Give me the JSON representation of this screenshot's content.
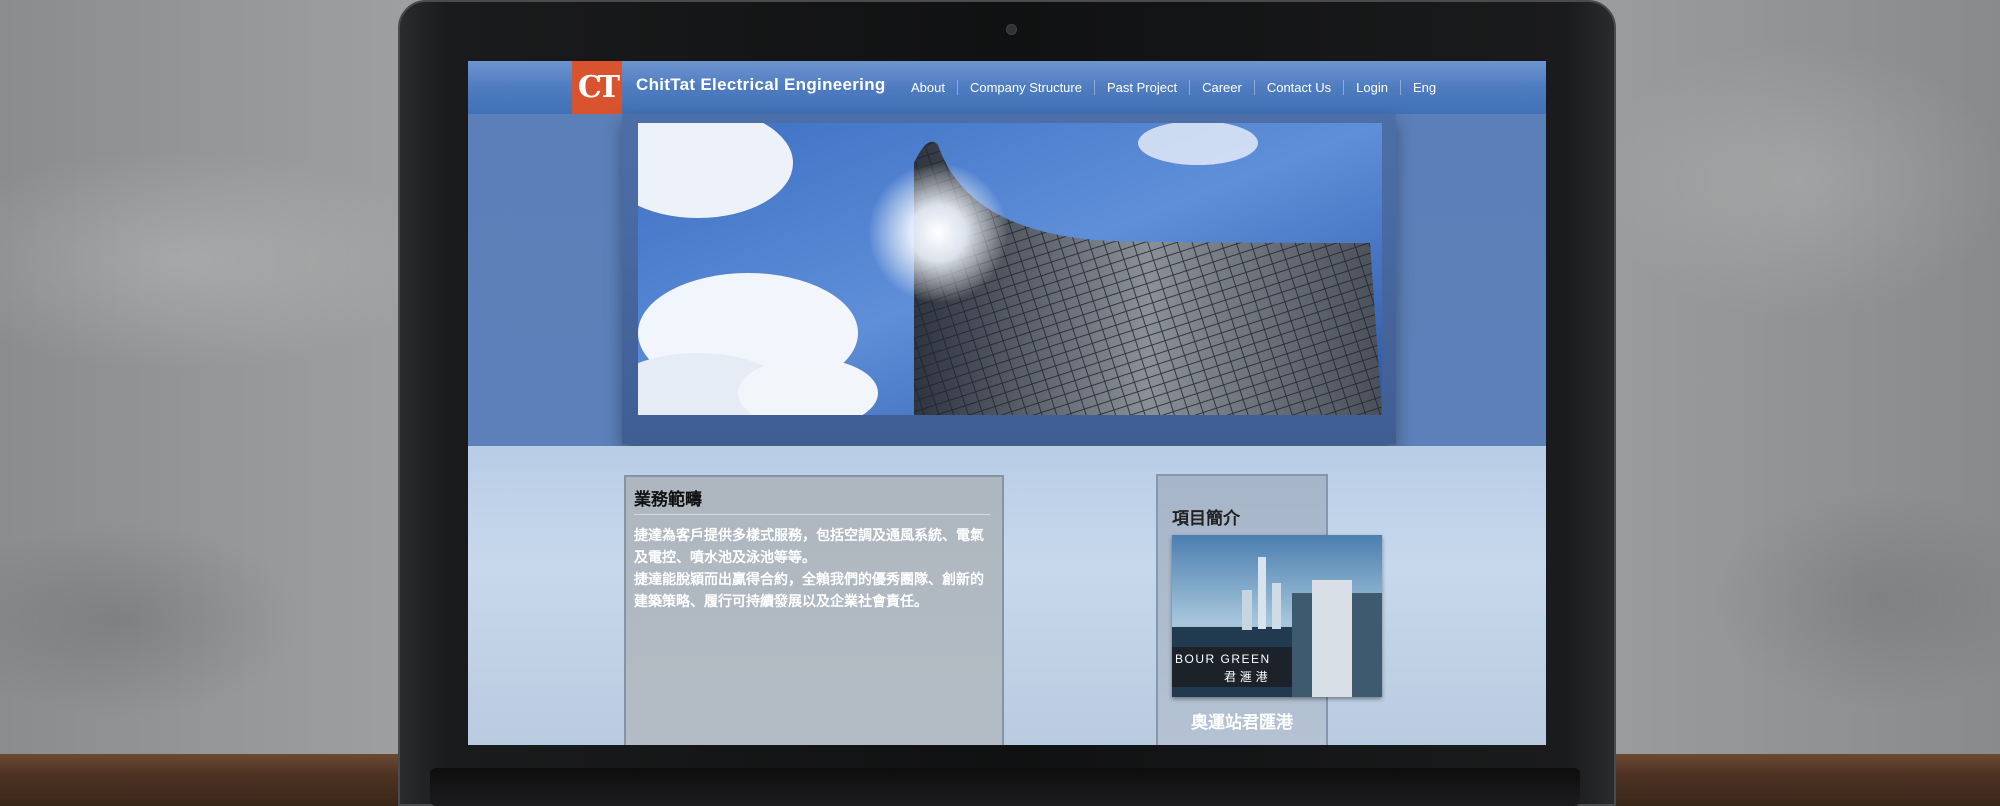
{
  "site": {
    "logo_text": "CT",
    "brand_name": "ChitTat Electrical Engineering"
  },
  "nav": {
    "items": [
      "About",
      "Company Structure",
      "Past Project",
      "Career",
      "Contact Us",
      "Login",
      "Eng"
    ]
  },
  "business": {
    "title": "業務範疇",
    "paragraph1": "捷達為客戶提供多樣式服務，包括空調及通風系統、電氣及電控、噴水池及泳池等等。",
    "paragraph2": "捷達能脫穎而出贏得合約，全賴我們的優秀團隊、創新的建築策略、履行可持續發展以及企業社會責任。"
  },
  "projects": {
    "title": "項目簡介",
    "thumb_brand_en": "BOUR GREEN",
    "thumb_brand_zh": "君 滙 港",
    "caption": "奧運站君匯港"
  },
  "colors": {
    "nav_bar": "#4f7cc0",
    "logo_bg": "#d8532e",
    "hero_band": "#5b7fb8",
    "lower_band": "#c7d8ec"
  }
}
